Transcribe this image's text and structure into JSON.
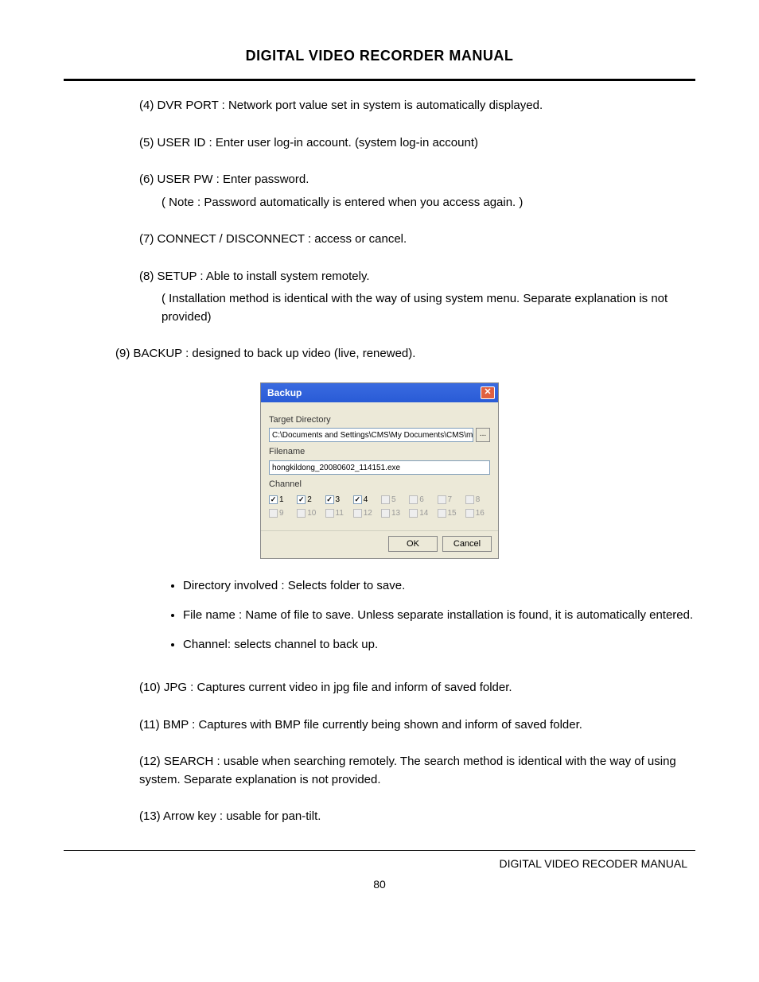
{
  "header": {
    "title": "DIGITAL VIDEO RECORDER MANUAL"
  },
  "items": {
    "i4": "(4) DVR PORT : Network port value set in system is automatically displayed.",
    "i5": "(5) USER ID : Enter user log-in account. (system log-in account)",
    "i6_a": "(6) USER PW : Enter password.",
    "i6_b": "( Note : Password automatically is entered when you access again. )",
    "i7": "(7) CONNECT / DISCONNECT : access or cancel.",
    "i8_a": "(8) SETUP : Able to install system remotely.",
    "i8_b": "( Installation method is identical with the way of using system menu. Separate explanation is not provided)",
    "i9": "(9) BACKUP : designed to back up video (live, renewed).",
    "b1": "Directory involved : Selects folder to save.",
    "b2": "File name : Name of file to save. Unless separate installation is found, it is automatically entered.",
    "b3": "Channel: selects channel to back up.",
    "i10": "(10) JPG : Captures current video in jpg file and inform of saved folder.",
    "i11": "(11) BMP : Captures with BMP file currently being shown and inform of saved folder.",
    "i12": "(12) SEARCH : usable when searching remotely. The search method is identical with the way of using system. Separate explanation is not provided.",
    "i13": "(13) Arrow key : usable for pan-tilt."
  },
  "dialog": {
    "title": "Backup",
    "target_label": "Target Directory",
    "target_value": "C:\\Documents and Settings\\CMS\\My Documents\\CMS\\mpg",
    "browse": "...",
    "filename_label": "Filename",
    "filename_value": "hongkildong_20080602_114151.exe",
    "channel_label": "Channel",
    "channels": [
      {
        "n": "1",
        "on": true,
        "en": true
      },
      {
        "n": "2",
        "on": true,
        "en": true
      },
      {
        "n": "3",
        "on": true,
        "en": true
      },
      {
        "n": "4",
        "on": true,
        "en": true
      },
      {
        "n": "5",
        "on": false,
        "en": false
      },
      {
        "n": "6",
        "on": false,
        "en": false
      },
      {
        "n": "7",
        "on": false,
        "en": false
      },
      {
        "n": "8",
        "on": false,
        "en": false
      },
      {
        "n": "9",
        "on": false,
        "en": false
      },
      {
        "n": "10",
        "on": false,
        "en": false
      },
      {
        "n": "11",
        "on": false,
        "en": false
      },
      {
        "n": "12",
        "on": false,
        "en": false
      },
      {
        "n": "13",
        "on": false,
        "en": false
      },
      {
        "n": "14",
        "on": false,
        "en": false
      },
      {
        "n": "15",
        "on": false,
        "en": false
      },
      {
        "n": "16",
        "on": false,
        "en": false
      }
    ],
    "ok": "OK",
    "cancel": "Cancel"
  },
  "footer": {
    "label": "DIGITAL VIDEO RECODER MANUAL",
    "page": "80"
  }
}
